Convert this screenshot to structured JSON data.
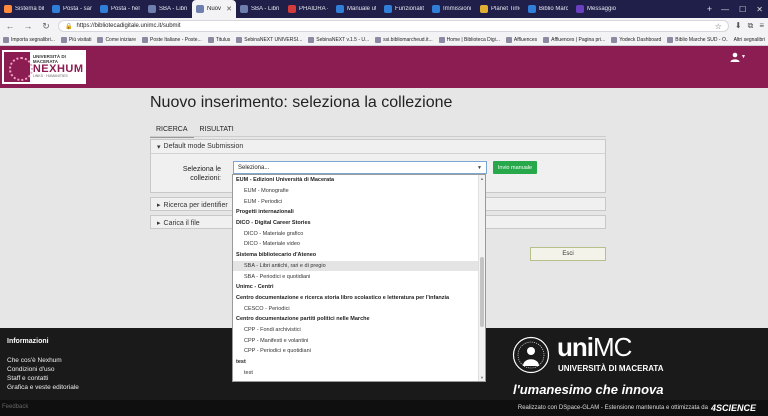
{
  "browser": {
    "tabs": [
      {
        "label": "Sistema bibli",
        "color": "#ff8a3c",
        "active": false
      },
      {
        "label": "Posta - sara",
        "color": "#2f7fd8",
        "active": false
      },
      {
        "label": "Posta - helpl",
        "color": "#2f7fd8",
        "active": false
      },
      {
        "label": "SBA - Libri a",
        "color": "#6e7fae",
        "active": false
      },
      {
        "label": "Nuovo in",
        "color": "#6e7fae",
        "active": true
      },
      {
        "label": "SBA - Libri a",
        "color": "#6e7fae",
        "active": false
      },
      {
        "label": "PHAIDRA - C",
        "color": "#d33a3a",
        "active": false
      },
      {
        "label": "Manuale ute",
        "color": "#2f7fd8",
        "active": false
      },
      {
        "label": "Funzionalità",
        "color": "#2f7fd8",
        "active": false
      },
      {
        "label": "Immissioni d",
        "color": "#2f7fd8",
        "active": false
      },
      {
        "label": "Planet Time WE",
        "color": "#e0b030",
        "active": false
      },
      {
        "label": "Biblio Marche",
        "color": "#2f7fd8",
        "active": false
      },
      {
        "label": "Messaggio o",
        "color": "#6a3fc0",
        "active": false
      }
    ],
    "url": "https://bibliotecadigitale.unimc.it/submit",
    "bookmarks": [
      "Importa segnalibri...",
      "Più visitati",
      "Come iniziare",
      "Poste Italiane - Poste...",
      "Titulus",
      "SebinaNEXT UNIVERSI...",
      "SebinaNEXT v.1.5 - U...",
      "ssi.bibliomarcheud.it...",
      "Home | Biblioteca Digi...",
      "Affluences",
      "Affluences | Pagina pri...",
      "Yodeck Dashboard",
      "Biblio Marche SUD - O..."
    ],
    "bookmarks_other": "Altri segnalibri"
  },
  "header": {
    "logo_line1": "UNIVERSITÀ DI MACERATA",
    "logo_line2": "NEXHUM",
    "logo_line3": "LINKS · HUMANITIES"
  },
  "main": {
    "title": "Nuovo inserimento: seleziona la collezione",
    "tabs": [
      "RICERCA",
      "RISULTATI"
    ],
    "default_panel_title": "Default mode Submission",
    "select_label": "Seleziona le collezioni:",
    "select_value": "Seleziona...",
    "invio_button": "Invio manuale",
    "ricerca_panel_title": "Ricerca per identifier",
    "carica_panel_title": "Carica il file",
    "esci_button": "Esci"
  },
  "dropdown": {
    "items": [
      {
        "label": "EUM - Edizioni Università di Macerata",
        "type": "group"
      },
      {
        "label": "EUM - Monografie",
        "type": "opt"
      },
      {
        "label": "EUM - Periodici",
        "type": "opt"
      },
      {
        "label": "Progetti internazionali",
        "type": "group"
      },
      {
        "label": "DICO - Digital Career Stories",
        "type": "group"
      },
      {
        "label": "DICO - Materiale grafico",
        "type": "opt"
      },
      {
        "label": "DICO - Materiale video",
        "type": "opt"
      },
      {
        "label": "Sistema bibliotecario d'Ateneo",
        "type": "group"
      },
      {
        "label": "SBA - Libri antichi, rari e di pregio",
        "type": "opt",
        "highlight": true
      },
      {
        "label": "SBA - Periodici e quotidiani",
        "type": "opt"
      },
      {
        "label": "Unimc - Centri",
        "type": "group"
      },
      {
        "label": "Centro documentazione e ricerca storia libro scolastico e letteratura per l'infanzia",
        "type": "group"
      },
      {
        "label": "CESCO - Periodici",
        "type": "opt"
      },
      {
        "label": "Centro documentazione partiti politici nelle Marche",
        "type": "group"
      },
      {
        "label": "CPP - Fondi archivistici",
        "type": "opt"
      },
      {
        "label": "CPP - Manifesti e volantini",
        "type": "opt"
      },
      {
        "label": "CPP - Periodici e quotidiani",
        "type": "opt"
      },
      {
        "label": "test",
        "type": "group"
      },
      {
        "label": "test",
        "type": "opt"
      }
    ]
  },
  "footer": {
    "title": "Informazioni",
    "links": [
      "Che cos'è Nexhum",
      "Condizioni d'uso",
      "Staff e contatti",
      "Grafica e veste editoriale"
    ],
    "brand_word": "uni",
    "brand_word_light": "MC",
    "brand_sub": "UNIVERSITÀ DI MACERATA",
    "slogan": "l'umanesimo che innova",
    "feedback": "Feedback",
    "powered": "Realizzato con DSpace-GLAM - Estensione mantenuta e ottimizzata da",
    "powered_brand": "4SCIENCE"
  },
  "colors": {
    "header_bg": "#8c1d52",
    "invio_button": "#27a84a",
    "footer_bg": "#1a1a1a"
  }
}
